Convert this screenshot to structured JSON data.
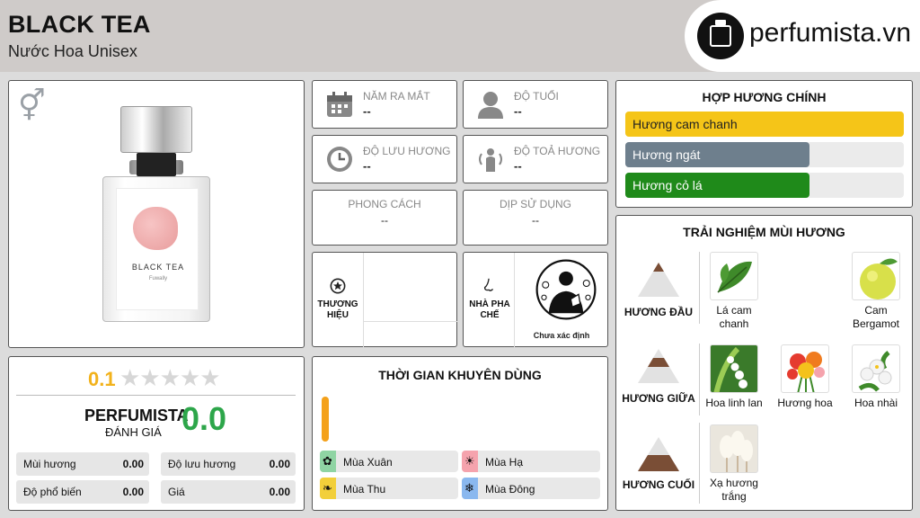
{
  "header": {
    "title": "BLACK TEA",
    "subtitle": "Nước Hoa Unisex",
    "logo_text": "perfumista.vn"
  },
  "product": {
    "gender_icon": "male-female-icon",
    "bottle_label_name": "BLACK TEA",
    "bottle_label_brand": "Fuwally"
  },
  "rating": {
    "score": "0.1",
    "stars": "★★★★★",
    "stars_filled": 0,
    "perfumista": "PERFUMISTA",
    "danh_gia": "ĐÁNH GIÁ",
    "perfumista_score": "0.0",
    "metrics": [
      {
        "label": "Mùi hương",
        "value": "0.00"
      },
      {
        "label": "Độ lưu hương",
        "value": "0.00"
      },
      {
        "label": "Độ phổ biến",
        "value": "0.00"
      },
      {
        "label": "Giá",
        "value": "0.00"
      }
    ]
  },
  "info": {
    "nam_ra_mat": {
      "label": "NĂM RA MẮT",
      "value": "--",
      "icon": "calendar-icon"
    },
    "do_tuoi": {
      "label": "ĐỘ TUỔI",
      "value": "--",
      "icon": "person-icon"
    },
    "do_luu_huong": {
      "label": "ĐỘ LƯU HƯƠNG",
      "value": "--",
      "icon": "clock-icon"
    },
    "do_toa_huong": {
      "label": "ĐỘ TOẢ HƯƠNG",
      "value": "--",
      "icon": "radiating-person-icon"
    },
    "phong_cach": {
      "label": "PHONG CÁCH",
      "value": "--"
    },
    "dip_su_dung": {
      "label": "DỊP SỬ DỤNG",
      "value": "--"
    },
    "thuong_hieu": {
      "label": "THƯƠNG HIỆU",
      "icon": "star-badge-icon"
    },
    "nha_pha_che": {
      "label": "NHÀ PHA CHẾ",
      "icon": "nose-icon",
      "name": "Chưa xác định"
    }
  },
  "seasons": {
    "title": "THỜI GIAN KHUYÊN DÙNG",
    "level": 0.5,
    "items": [
      {
        "label": "Mùa Xuân",
        "color": "#8fd4a3",
        "icon": "flower-icon"
      },
      {
        "label": "Mùa Hạ",
        "color": "#f5a3ad",
        "icon": "sun-icon"
      },
      {
        "label": "Mùa Thu",
        "color": "#f2cf3a",
        "icon": "leaf-icon"
      },
      {
        "label": "Mùa Đông",
        "color": "#8ab8ef",
        "icon": "snowflake-icon"
      }
    ]
  },
  "accords": {
    "title": "HỢP HƯƠNG CHÍNH",
    "items": [
      {
        "label": "Hương cam chanh",
        "color": "#f5c518",
        "level": 1.0,
        "text_color": "#222222"
      },
      {
        "label": "Hương ngát",
        "color": "#6e7f8d",
        "level": 0.66,
        "text_color": "#ffffff"
      },
      {
        "label": "Hương cỏ lá",
        "color": "#1f8a1a",
        "level": 0.66,
        "text_color": "#ffffff"
      }
    ]
  },
  "notes": {
    "title": "TRẢI NGHIỆM MÙI HƯƠNG",
    "top": {
      "label": "HƯƠNG ĐẦU",
      "items": [
        "Lá cam chanh",
        "Cam Bergamot"
      ]
    },
    "middle": {
      "label": "HƯƠNG GIỮA",
      "items": [
        "Hoa linh lan",
        "Hương hoa",
        "Hoa nhài"
      ]
    },
    "base": {
      "label": "HƯƠNG CUỐI",
      "items": [
        "Xạ hương trắng"
      ]
    }
  }
}
